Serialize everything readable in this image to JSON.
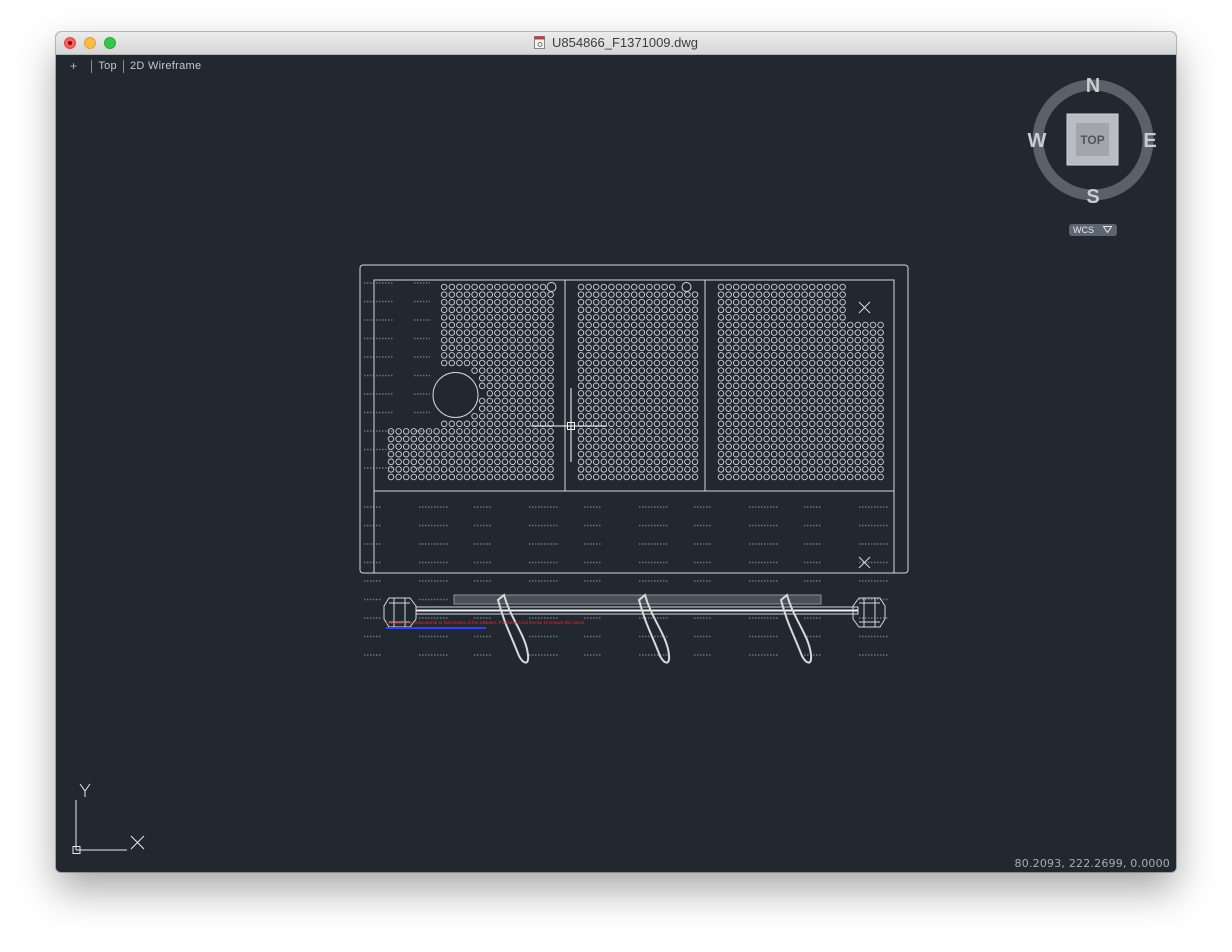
{
  "window": {
    "title": "U854866_F1371009.dwg"
  },
  "viewport": {
    "plus_label": "+",
    "view_label": "Top",
    "style_label": "2D Wireframe",
    "coordinates": "80.2093,  222.2699, 0.0000"
  },
  "viewcube": {
    "north": "N",
    "south": "S",
    "east": "E",
    "west": "W",
    "face": "TOP",
    "wcs_label": "WCS"
  },
  "ucs": {
    "y_label": "Y",
    "x_label": "X"
  },
  "drawing": {
    "watermark_line1": "Created by an educational or trial version of the software. Purchase a full license to remove this notice.",
    "watermark_line2": ""
  },
  "colors": {
    "canvas": "#212830",
    "linework": "#d7d9dc",
    "watermark_red": "#ff2020",
    "watermark_blue": "#3040ff"
  }
}
